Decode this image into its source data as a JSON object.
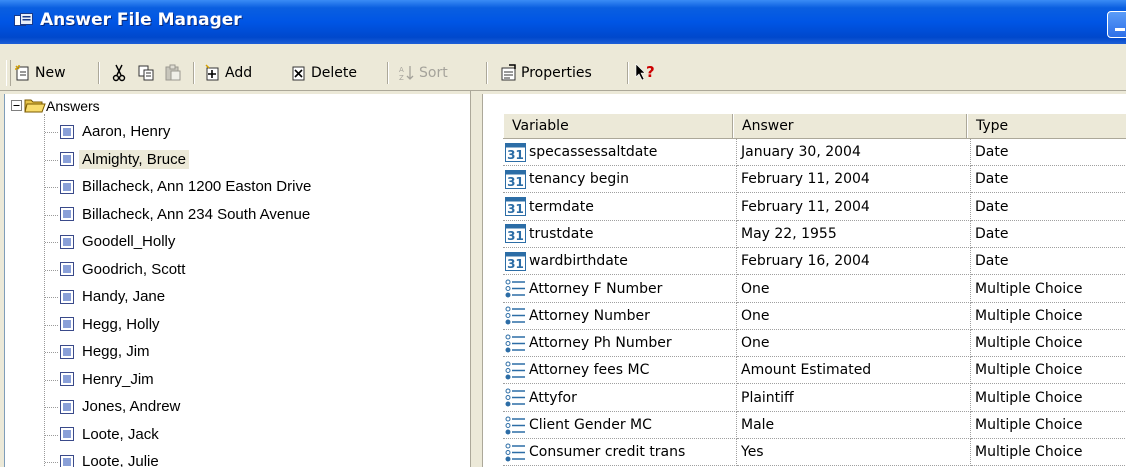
{
  "window": {
    "title": "Answer File Manager"
  },
  "toolbar": {
    "new": "New",
    "add": "Add",
    "delete": "Delete",
    "sort": "Sort",
    "properties": "Properties"
  },
  "tree": {
    "root": "Answers",
    "items": [
      {
        "label": "Aaron, Henry"
      },
      {
        "label": "Almighty, Bruce"
      },
      {
        "label": "Billacheck, Ann 1200 Easton Drive"
      },
      {
        "label": "Billacheck, Ann 234 South Avenue"
      },
      {
        "label": "Goodell_Holly"
      },
      {
        "label": "Goodrich, Scott"
      },
      {
        "label": "Handy, Jane"
      },
      {
        "label": "Hegg, Holly"
      },
      {
        "label": "Hegg, Jim"
      },
      {
        "label": "Henry_Jim"
      },
      {
        "label": "Jones, Andrew"
      },
      {
        "label": "Loote, Jack"
      },
      {
        "label": "Loote, Julie"
      }
    ],
    "selected_index": 1
  },
  "grid": {
    "columns": [
      "Variable",
      "Answer",
      "Type"
    ],
    "rows": [
      {
        "icon": "calendar-icon",
        "variable": "specassessaltdate",
        "answer": "January 30, 2004",
        "type": "Date"
      },
      {
        "icon": "calendar-icon",
        "variable": "tenancy begin",
        "answer": "February 11, 2004",
        "type": "Date"
      },
      {
        "icon": "calendar-icon",
        "variable": "termdate",
        "answer": "February 11, 2004",
        "type": "Date"
      },
      {
        "icon": "calendar-icon",
        "variable": "trustdate",
        "answer": "May 22, 1955",
        "type": "Date"
      },
      {
        "icon": "calendar-icon",
        "variable": "wardbirthdate",
        "answer": "February 16, 2004",
        "type": "Date"
      },
      {
        "icon": "list-icon",
        "variable": "Attorney F Number",
        "answer": "One",
        "type": "Multiple Choice"
      },
      {
        "icon": "list-icon",
        "variable": "Attorney Number",
        "answer": "One",
        "type": "Multiple Choice"
      },
      {
        "icon": "list-icon",
        "variable": "Attorney Ph Number",
        "answer": "One",
        "type": "Multiple Choice"
      },
      {
        "icon": "list-icon",
        "variable": "Attorney fees MC",
        "answer": "Amount Estimated",
        "type": "Multiple Choice"
      },
      {
        "icon": "list-icon",
        "variable": "Attyfor",
        "answer": "Plaintiff",
        "type": "Multiple Choice"
      },
      {
        "icon": "list-icon",
        "variable": "Client Gender MC",
        "answer": "Male",
        "type": "Multiple Choice"
      },
      {
        "icon": "list-icon",
        "variable": "Consumer credit trans",
        "answer": "Yes",
        "type": "Multiple Choice"
      }
    ]
  },
  "calendar_icon_text": "31",
  "colors": {
    "titlebar": "#0055e5",
    "window_bg": "#ece9d8",
    "selection": "#ece9d8",
    "calendar_icon": "#2c6da6"
  }
}
